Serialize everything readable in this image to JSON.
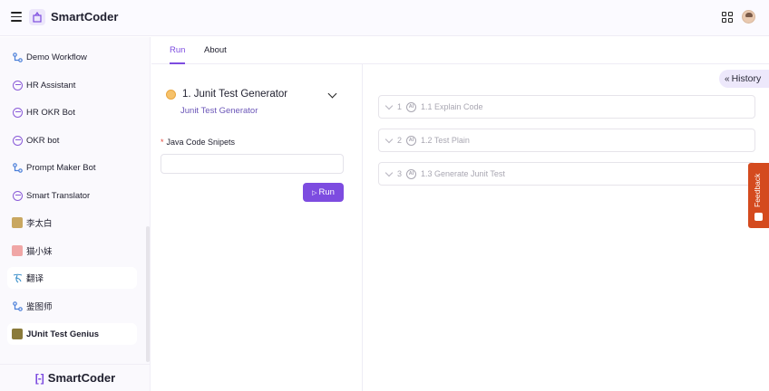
{
  "header": {
    "brand": "SmartCoder",
    "icons": [
      "menu-icon",
      "logo-icon",
      "apps-grid-icon",
      "user-avatar"
    ]
  },
  "sidebar": {
    "items": [
      {
        "label": "Demo Workflow",
        "icon": "workflow-icon"
      },
      {
        "label": "HR Assistant",
        "icon": "chat-bot-icon"
      },
      {
        "label": "HR OKR Bot",
        "icon": "chat-bot-icon"
      },
      {
        "label": "OKR bot",
        "icon": "chat-bot-icon"
      },
      {
        "label": "Prompt Maker Bot",
        "icon": "workflow-icon"
      },
      {
        "label": "Smart Translator",
        "icon": "chat-bot-icon"
      },
      {
        "label": "李太白",
        "icon": "image-avatar"
      },
      {
        "label": "猫小妹",
        "icon": "image-avatar"
      },
      {
        "label": "翻译",
        "icon": "translate-icon"
      },
      {
        "label": "鉴图师",
        "icon": "workflow-icon"
      },
      {
        "label": "JUnit Test Genius",
        "icon": "image-avatar",
        "active": true
      }
    ],
    "footer_brand": "SmartCoder",
    "footer_mark": "[-]"
  },
  "tabs": [
    {
      "label": "Run",
      "active": true
    },
    {
      "label": "About",
      "active": false
    }
  ],
  "workflow": {
    "title": "1. Junit Test Generator",
    "subtitle": "Junit Test Generator",
    "field_label": "Java Code Snipets",
    "field_required_mark": "*",
    "field_value": "",
    "run_label": "Run"
  },
  "history_label": "History",
  "steps": [
    {
      "num": "1",
      "badge": "AI",
      "label": "1.1 Explain Code"
    },
    {
      "num": "2",
      "badge": "AI",
      "label": "1.2 Test Plain"
    },
    {
      "num": "3",
      "badge": "AI",
      "label": "1.3 Generate Junit Test"
    }
  ],
  "feedback_label": "Feedback",
  "colors": {
    "accent": "#7d4ce0",
    "feedback": "#d44a1e"
  }
}
